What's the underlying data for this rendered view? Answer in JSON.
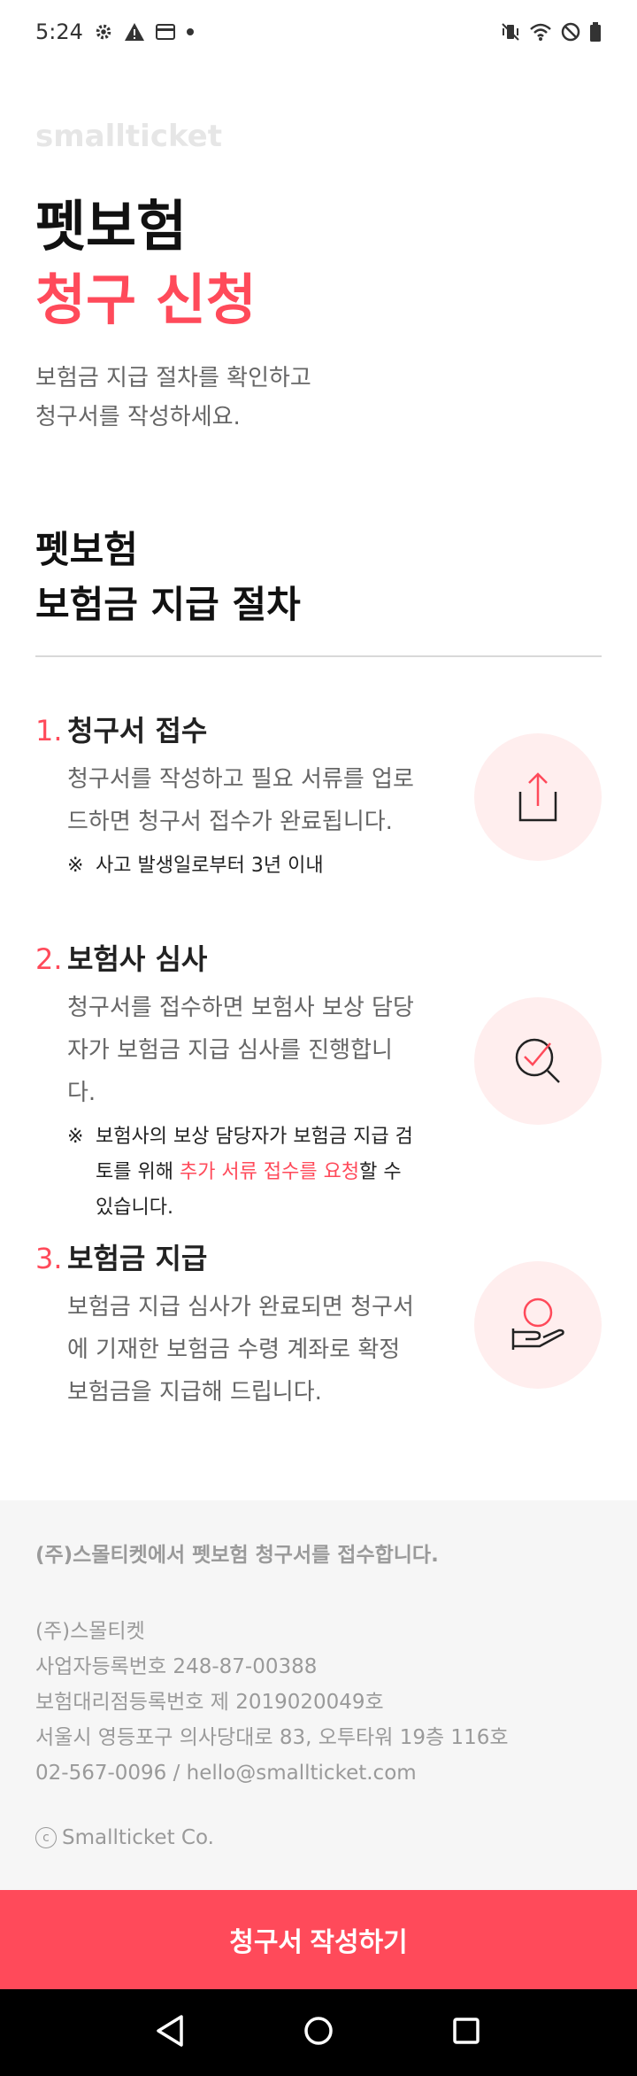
{
  "status_bar": {
    "time": "5:24",
    "icons_left": [
      "settings-icon",
      "warning-icon",
      "card-icon",
      "dot-icon"
    ],
    "icons_right": [
      "vibrate-icon",
      "wifi-icon",
      "dnd-icon",
      "battery-icon"
    ]
  },
  "logo": "smallticket",
  "hero": {
    "line1": "펫보험",
    "line2": "청구 신청",
    "desc_line1": "보험금 지급 절차를 확인하고",
    "desc_line2": "청구서를 작성하세요."
  },
  "section": {
    "title_line1": "펫보험",
    "title_line2": "보험금 지급 절차"
  },
  "steps": [
    {
      "num": "1.",
      "title": "청구서 접수",
      "body": "청구서를 작성하고 필요 서류를 업로드하면 청구서 접수가 완료됩니다.",
      "note": "사고 발생일로부터 3년 이내",
      "icon": "upload-icon"
    },
    {
      "num": "2.",
      "title": "보험사 심사",
      "body": "청구서를 접수하면 보험사 보상 담당자가 보험금 지급 심사를 진행합니다.",
      "note_pre": "보험사의 보상 담당자가 보험금 지급 검토를 위해 ",
      "note_highlight": "추가 서류 접수를 요청",
      "note_post": "할 수 있습니다.",
      "icon": "review-check-icon"
    },
    {
      "num": "3.",
      "title": "보험금 지급",
      "body": "보험금 지급 심사가 완료되면 청구서에 기재한 보험금 수령 계좌로 확정 보험금을 지급해 드립니다.",
      "icon": "payment-hand-icon"
    }
  ],
  "note_mark": "※",
  "footer": {
    "notice": "(주)스몰티켓에서 펫보험 청구서를 접수합니다.",
    "company": "(주)스몰티켓",
    "business_no": "사업자등록번호 248-87-00388",
    "agency_no": "보험대리점등록번호 제 2019020049호",
    "address": "서울시 영등포구 의사당대로 83, 오투타워 19층 116호",
    "contact": "02-567-0096 / hello@smallticket.com",
    "copyright_symbol": "c",
    "copyright": "Smallticket Co."
  },
  "cta": {
    "label": "청구서 작성하기"
  },
  "colors": {
    "accent": "#ff4a5a",
    "icon_bg": "#ffeeee",
    "footer_bg": "#f6f6f6"
  }
}
